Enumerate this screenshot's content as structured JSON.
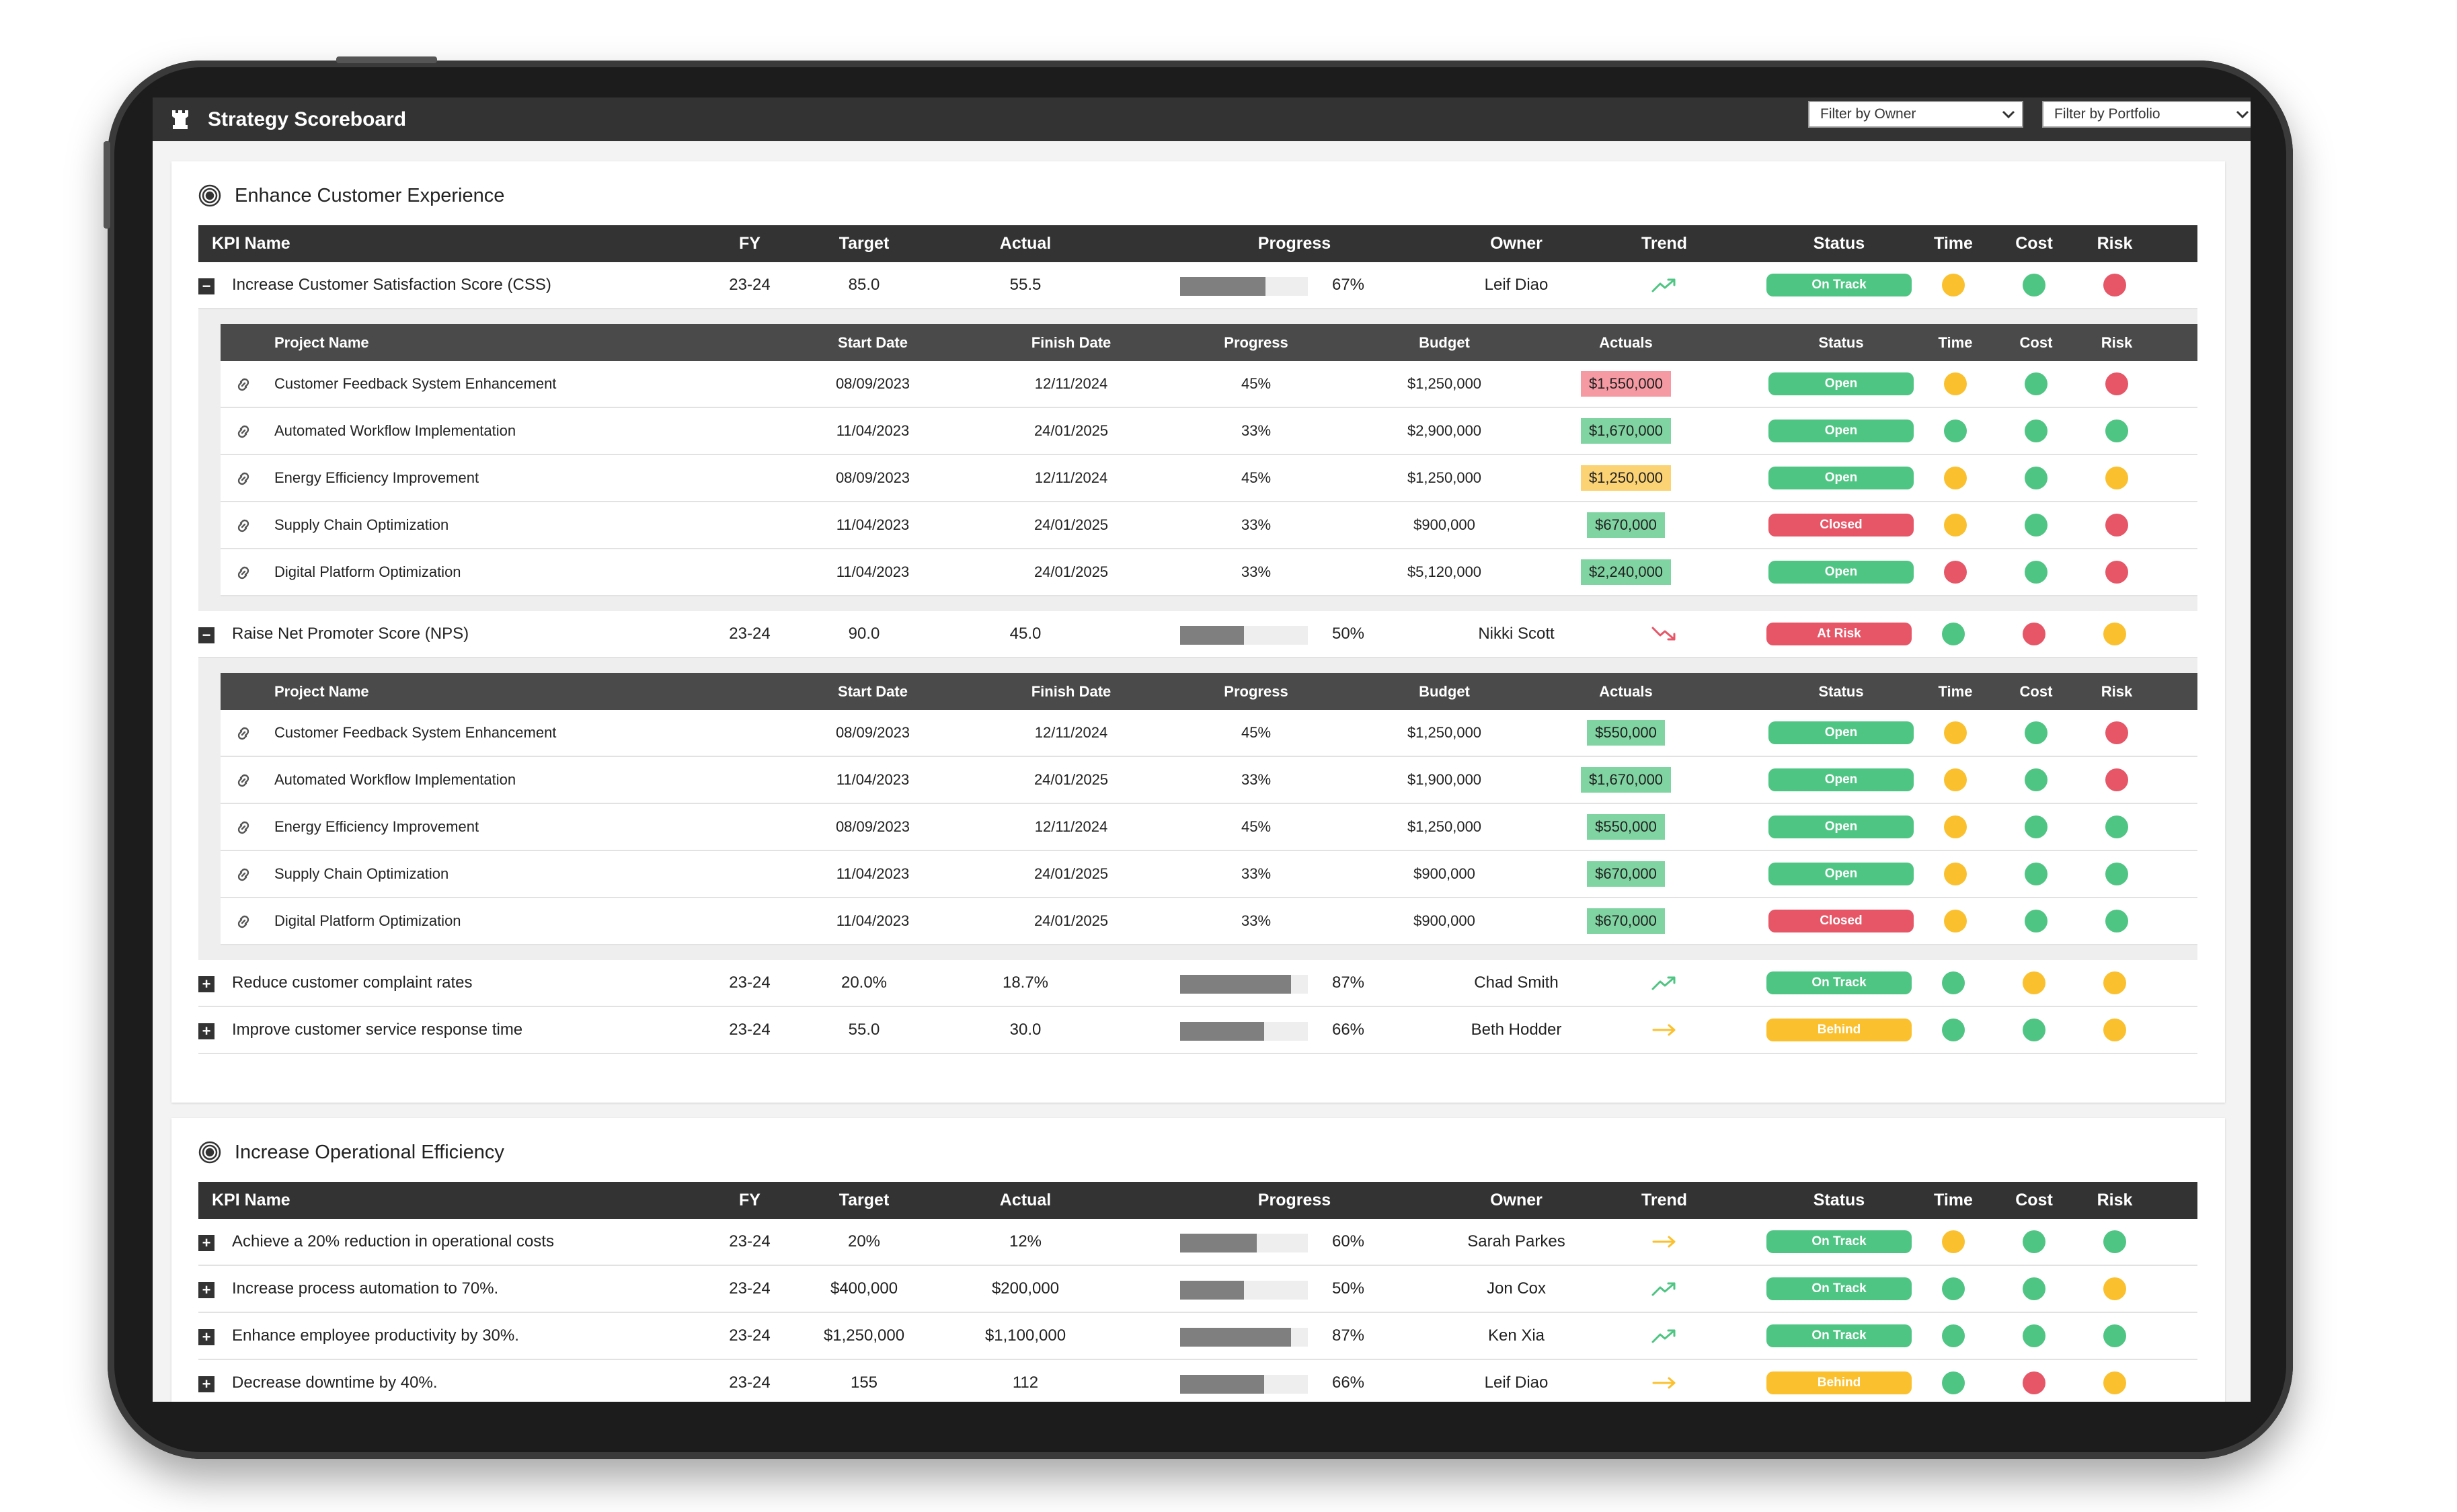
{
  "app": {
    "title": "Strategy Scoreboard"
  },
  "filters": {
    "owner": "Filter by Owner",
    "portfolio": "Filter by Portfolio"
  },
  "colors": {
    "green": "#4fc583",
    "amber": "#fbc02d",
    "red": "#e65667",
    "header": "#333333",
    "bg_green": "#7fd4a1",
    "bg_red": "#f59aa3",
    "bg_amber": "#fbd374"
  },
  "kpi_headers": {
    "name": "KPI Name",
    "fy": "FY",
    "target": "Target",
    "actual": "Actual",
    "progress": "Progress",
    "owner": "Owner",
    "trend": "Trend",
    "status": "Status",
    "time": "Time",
    "cost": "Cost",
    "risk": "Risk"
  },
  "project_headers": {
    "name": "Project Name",
    "start": "Start Date",
    "finish": "Finish Date",
    "progress": "Progress",
    "budget": "Budget",
    "actuals": "Actuals",
    "status": "Status",
    "time": "Time",
    "cost": "Cost",
    "risk": "Risk"
  },
  "sections": [
    {
      "title": "Enhance Customer Experience",
      "kpis": [
        {
          "name": "Increase Customer Satisfaction Score (CSS)",
          "expanded": true,
          "fy": "23-24",
          "target": "85.0",
          "actual": "55.5",
          "progress": 67,
          "progress_label": "67%",
          "owner": "Leif Diao",
          "trend": "up",
          "status": "On Track",
          "status_color": "green",
          "time": "amber",
          "cost": "green",
          "risk": "red",
          "projects": [
            {
              "name": "Customer Feedback System Enhancement",
              "start": "08/09/2023",
              "finish": "12/11/2024",
              "progress": "45%",
              "budget": "$1,250,000",
              "actuals": "$1,550,000",
              "actuals_color": "red",
              "status": "Open",
              "status_color": "green",
              "time": "amber",
              "cost": "green",
              "risk": "red"
            },
            {
              "name": "Automated Workflow Implementation",
              "start": "11/04/2023",
              "finish": "24/01/2025",
              "progress": "33%",
              "budget": "$2,900,000",
              "actuals": "$1,670,000",
              "actuals_color": "green",
              "status": "Open",
              "status_color": "green",
              "time": "green",
              "cost": "green",
              "risk": "green"
            },
            {
              "name": "Energy Efficiency Improvement",
              "start": "08/09/2023",
              "finish": "12/11/2024",
              "progress": "45%",
              "budget": "$1,250,000",
              "actuals": "$1,250,000",
              "actuals_color": "amber",
              "status": "Open",
              "status_color": "green",
              "time": "amber",
              "cost": "green",
              "risk": "amber"
            },
            {
              "name": "Supply Chain Optimization",
              "start": "11/04/2023",
              "finish": "24/01/2025",
              "progress": "33%",
              "budget": "$900,000",
              "actuals": "$670,000",
              "actuals_color": "green",
              "status": "Closed",
              "status_color": "red",
              "time": "amber",
              "cost": "green",
              "risk": "red"
            },
            {
              "name": "Digital Platform Optimization",
              "start": "11/04/2023",
              "finish": "24/01/2025",
              "progress": "33%",
              "budget": "$5,120,000",
              "actuals": "$2,240,000",
              "actuals_color": "green",
              "status": "Open",
              "status_color": "green",
              "time": "red",
              "cost": "green",
              "risk": "red"
            }
          ]
        },
        {
          "name": "Raise Net Promoter Score (NPS)",
          "expanded": true,
          "fy": "23-24",
          "target": "90.0",
          "actual": "45.0",
          "progress": 50,
          "progress_label": "50%",
          "owner": "Nikki Scott",
          "trend": "down",
          "status": "At Risk",
          "status_color": "red",
          "time": "green",
          "cost": "red",
          "risk": "amber",
          "projects": [
            {
              "name": "Customer Feedback System Enhancement",
              "start": "08/09/2023",
              "finish": "12/11/2024",
              "progress": "45%",
              "budget": "$1,250,000",
              "actuals": "$550,000",
              "actuals_color": "green",
              "status": "Open",
              "status_color": "green",
              "time": "amber",
              "cost": "green",
              "risk": "red"
            },
            {
              "name": "Automated Workflow Implementation",
              "start": "11/04/2023",
              "finish": "24/01/2025",
              "progress": "33%",
              "budget": "$1,900,000",
              "actuals": "$1,670,000",
              "actuals_color": "green",
              "status": "Open",
              "status_color": "green",
              "time": "amber",
              "cost": "green",
              "risk": "red"
            },
            {
              "name": "Energy Efficiency Improvement",
              "start": "08/09/2023",
              "finish": "12/11/2024",
              "progress": "45%",
              "budget": "$1,250,000",
              "actuals": "$550,000",
              "actuals_color": "green",
              "status": "Open",
              "status_color": "green",
              "time": "amber",
              "cost": "green",
              "risk": "green"
            },
            {
              "name": "Supply Chain Optimization",
              "start": "11/04/2023",
              "finish": "24/01/2025",
              "progress": "33%",
              "budget": "$900,000",
              "actuals": "$670,000",
              "actuals_color": "green",
              "status": "Open",
              "status_color": "green",
              "time": "amber",
              "cost": "green",
              "risk": "green"
            },
            {
              "name": "Digital Platform Optimization",
              "start": "11/04/2023",
              "finish": "24/01/2025",
              "progress": "33%",
              "budget": "$900,000",
              "actuals": "$670,000",
              "actuals_color": "green",
              "status": "Closed",
              "status_color": "red",
              "time": "amber",
              "cost": "green",
              "risk": "green"
            }
          ]
        },
        {
          "name": "Reduce customer complaint rates",
          "expanded": false,
          "fy": "23-24",
          "target": "20.0%",
          "actual": "18.7%",
          "progress": 87,
          "progress_label": "87%",
          "owner": "Chad Smith",
          "trend": "up",
          "status": "On Track",
          "status_color": "green",
          "time": "green",
          "cost": "amber",
          "risk": "amber"
        },
        {
          "name": "Improve customer service response time",
          "expanded": false,
          "fy": "23-24",
          "target": "55.0",
          "actual": "30.0",
          "progress": 66,
          "progress_label": "66%",
          "owner": "Beth Hodder",
          "trend": "flat",
          "status": "Behind",
          "status_color": "amber",
          "time": "green",
          "cost": "green",
          "risk": "amber"
        }
      ]
    },
    {
      "title": "Increase Operational Efficiency",
      "kpis": [
        {
          "name": "Achieve a 20% reduction in operational costs",
          "expanded": false,
          "fy": "23-24",
          "target": "20%",
          "actual": "12%",
          "progress": 60,
          "progress_label": "60%",
          "owner": "Sarah Parkes",
          "trend": "flat",
          "status": "On Track",
          "status_color": "green",
          "time": "amber",
          "cost": "green",
          "risk": "green"
        },
        {
          "name": "Increase process automation to 70%.",
          "expanded": false,
          "fy": "23-24",
          "target": "$400,000",
          "actual": "$200,000",
          "progress": 50,
          "progress_label": "50%",
          "owner": "Jon Cox",
          "trend": "up",
          "status": "On Track",
          "status_color": "green",
          "time": "green",
          "cost": "green",
          "risk": "amber"
        },
        {
          "name": "Enhance employee productivity by 30%.",
          "expanded": false,
          "fy": "23-24",
          "target": "$1,250,000",
          "actual": "$1,100,000",
          "progress": 87,
          "progress_label": "87%",
          "owner": "Ken Xia",
          "trend": "up",
          "status": "On Track",
          "status_color": "green",
          "time": "green",
          "cost": "green",
          "risk": "green"
        },
        {
          "name": "Decrease downtime by 40%.",
          "expanded": false,
          "fy": "23-24",
          "target": "155",
          "actual": "112",
          "progress": 66,
          "progress_label": "66%",
          "owner": "Leif Diao",
          "trend": "flat",
          "status": "Behind",
          "status_color": "amber",
          "time": "green",
          "cost": "red",
          "risk": "amber"
        }
      ]
    }
  ]
}
